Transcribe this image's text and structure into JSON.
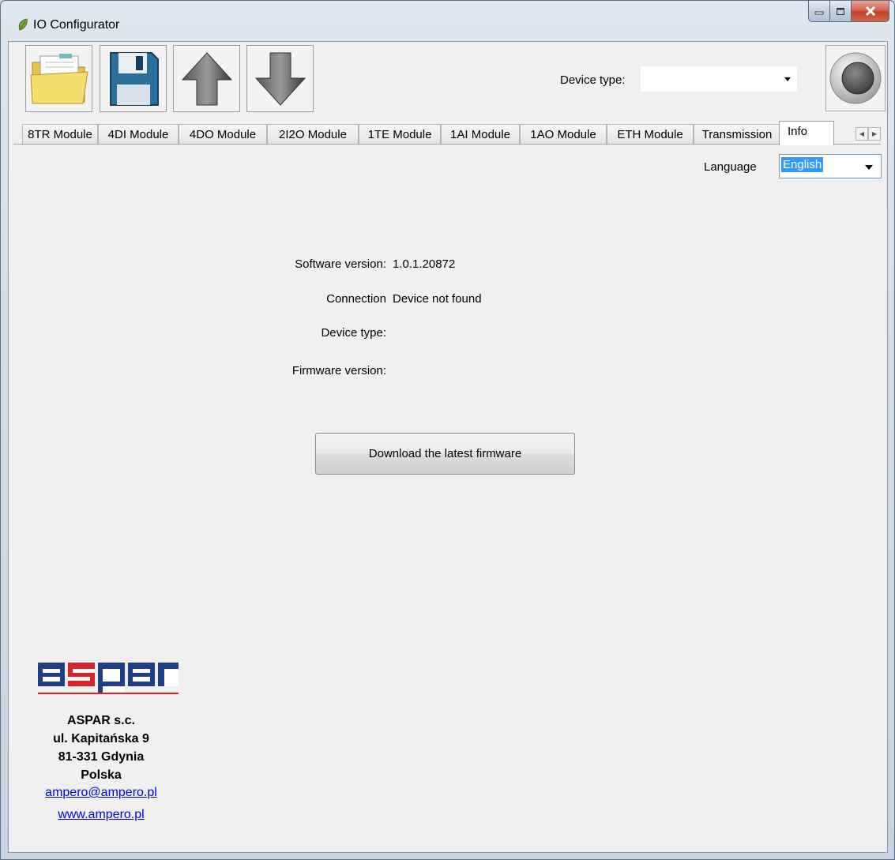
{
  "window": {
    "title": "IO Configurator"
  },
  "toolbar": {
    "device_type_label": "Device type:",
    "device_type_value": ""
  },
  "tabs": [
    {
      "label": "8TR Module"
    },
    {
      "label": "4DI Module"
    },
    {
      "label": "4DO Module"
    },
    {
      "label": "2I2O Module"
    },
    {
      "label": "1TE Module"
    },
    {
      "label": "1AI Module"
    },
    {
      "label": "1AO Module"
    },
    {
      "label": "ETH Module"
    },
    {
      "label": "Transmission"
    },
    {
      "label": "Info"
    }
  ],
  "info": {
    "language_label": "Language",
    "language_value": "English",
    "software_version_label": "Software version:",
    "software_version_value": "1.0.1.20872",
    "connection_label": "Connection",
    "connection_value": "Device not found",
    "device_type_label": "Device type:",
    "device_type_value": "",
    "firmware_version_label": "Firmware version:",
    "firmware_version_value": "",
    "download_button": "Download the latest firmware"
  },
  "company": {
    "logo_text": "aspar",
    "name": "ASPAR s.c.",
    "street": "ul. Kapitańska 9",
    "city": "81-331 Gdynia",
    "country": "Polska",
    "email": "ampero@ampero.pl",
    "website": "www.ampero.pl"
  },
  "colors": {
    "logo_blue": "#1f3f86",
    "logo_red": "#d8232a",
    "selection": "#3399ff",
    "link": "#0000ee"
  }
}
